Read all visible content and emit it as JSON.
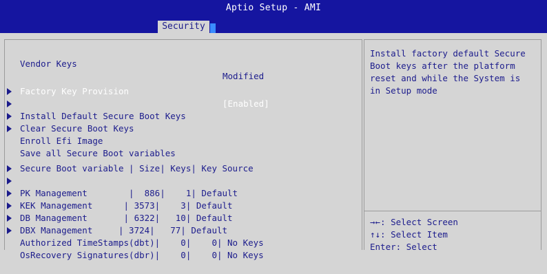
{
  "header": {
    "title": "Aptio Setup - AMI",
    "tabs": [
      "Security"
    ]
  },
  "main": {
    "vendor_keys": {
      "label": "Vendor Keys",
      "value": "Modified"
    },
    "factory_key_provision": {
      "label": "Factory Key Provision",
      "value": "[Enabled]"
    },
    "menu_items": [
      "Install Default Secure Boot Keys",
      "Clear Secure Boot Keys",
      "Enroll Efi Image",
      "Save all Secure Boot variables"
    ],
    "table_header": "Secure Boot variable | Size| Keys| Key Source",
    "table_rows": [
      "PK Management        |  886|    1| Default",
      "KEK Management      | 3573|    3| Default",
      "DB Management       | 6322|   10| Default",
      "DBX Management     | 3724|   77| Default",
      "Authorized TimeStamps(dbt)|    0|    0| No Keys",
      "OsRecovery Signatures(dbr)|    0|    0| No Keys"
    ]
  },
  "help": {
    "text": "Install factory default Secure\nBoot keys after the platform\nreset and while the System is\nin Setup mode",
    "keys": [
      "→←: Select Screen",
      "↑↓: Select Item",
      "Enter: Select"
    ]
  },
  "colors": {
    "header_bg": "#1515a0",
    "body_bg": "#d5d5d5",
    "text": "#1c1c8c",
    "highlight": "#ffffff"
  }
}
